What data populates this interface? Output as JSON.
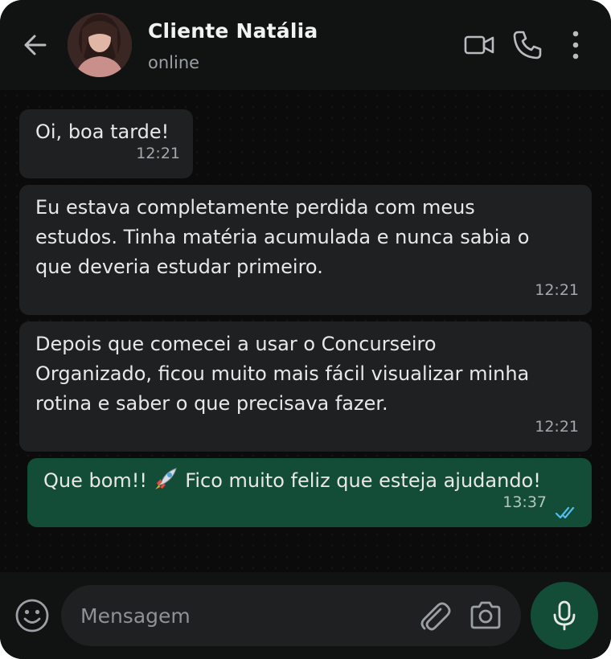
{
  "header": {
    "contact_name": "Cliente Natália",
    "status": "online",
    "icons": [
      "back-arrow-icon",
      "video-call-icon",
      "phone-icon",
      "more-vertical-icon"
    ]
  },
  "messages": [
    {
      "direction": "incoming",
      "text": "Oi, boa tarde!",
      "time": "12:21"
    },
    {
      "direction": "incoming",
      "text": "Eu estava completamente perdida com meus\nestudos. Tinha matéria acumulada e nunca sabia o\nque deveria estudar primeiro.",
      "time": "12:21"
    },
    {
      "direction": "incoming",
      "text": "Depois que comecei a usar o Concurseiro\nOrganizado, ficou muito mais fácil visualizar minha\nrotina e saber o que precisava fazer.",
      "time": "12:21"
    },
    {
      "direction": "outgoing",
      "text_before_emoji": "Que bom!! ",
      "emoji": "rocket",
      "text_after_emoji": " Fico muito feliz que esteja ajudando!",
      "time": "13:37",
      "status": "read"
    }
  ],
  "composer": {
    "placeholder": "Mensagem",
    "icons": [
      "emoji-icon",
      "attach-icon",
      "camera-icon",
      "mic-icon"
    ]
  },
  "colors": {
    "background": "#0b0b0b",
    "header": "#111212",
    "incoming_bubble": "#1f2021",
    "outgoing_bubble": "#134d37",
    "read_ticks": "#53bdeb"
  }
}
